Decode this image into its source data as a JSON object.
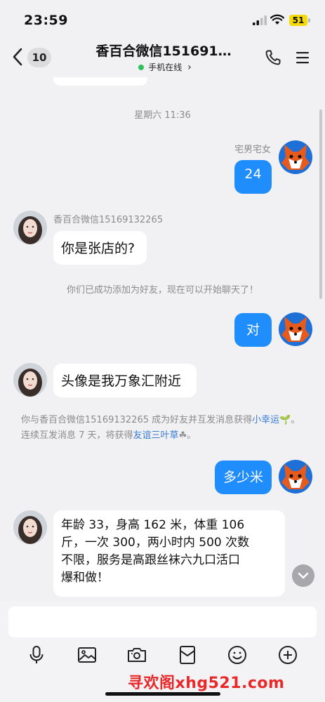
{
  "status_bar": {
    "time": "23:59",
    "battery": "51"
  },
  "header": {
    "unread_count": "10",
    "title": "香百合微信151691…",
    "online_status": "手机在线",
    "online_chevron": "›"
  },
  "chat": {
    "timestamp": "星期六 11:36",
    "messages": [
      {
        "side": "right",
        "sender": "宅男宅女",
        "text": "24"
      },
      {
        "side": "left",
        "sender": "香百合微信15169132265",
        "text": "你是张店的?"
      },
      {
        "side": "system",
        "text": "你们已成功添加为好友，现在可以开始聊天了！"
      },
      {
        "side": "right",
        "text": "对"
      },
      {
        "side": "left",
        "text": "头像是我万象汇附近"
      },
      {
        "side": "system_rich",
        "parts": [
          "你与香百合微信15169132265 成为好友并互发消息获得",
          "小幸运",
          "🌱。连续互发消息 7 天，将获得",
          "友谊三叶草",
          "☘。"
        ]
      },
      {
        "side": "right",
        "text": "多少米"
      },
      {
        "side": "left",
        "lines": [
          "年龄 33，身高 162 米，体重 106",
          "斤，一次 300，两小时内 500 次数",
          "不限，服务是高跟丝袜六九口活口",
          "爆和做！"
        ]
      }
    ]
  },
  "input": {
    "placeholder": ""
  },
  "toolbar": [
    "microphone-icon",
    "image-icon",
    "camera-icon",
    "red-packet-icon",
    "emoji-icon",
    "plus-icon"
  ],
  "watermark": "寻欢阁xhg521.com",
  "colors": {
    "bubble_out": "#1f8dfb",
    "bubble_in": "#ffffff",
    "online_dot": "#2dc25a",
    "link": "#3a7cd6",
    "watermark": "#e8292a",
    "battery": "#f5d90a"
  }
}
